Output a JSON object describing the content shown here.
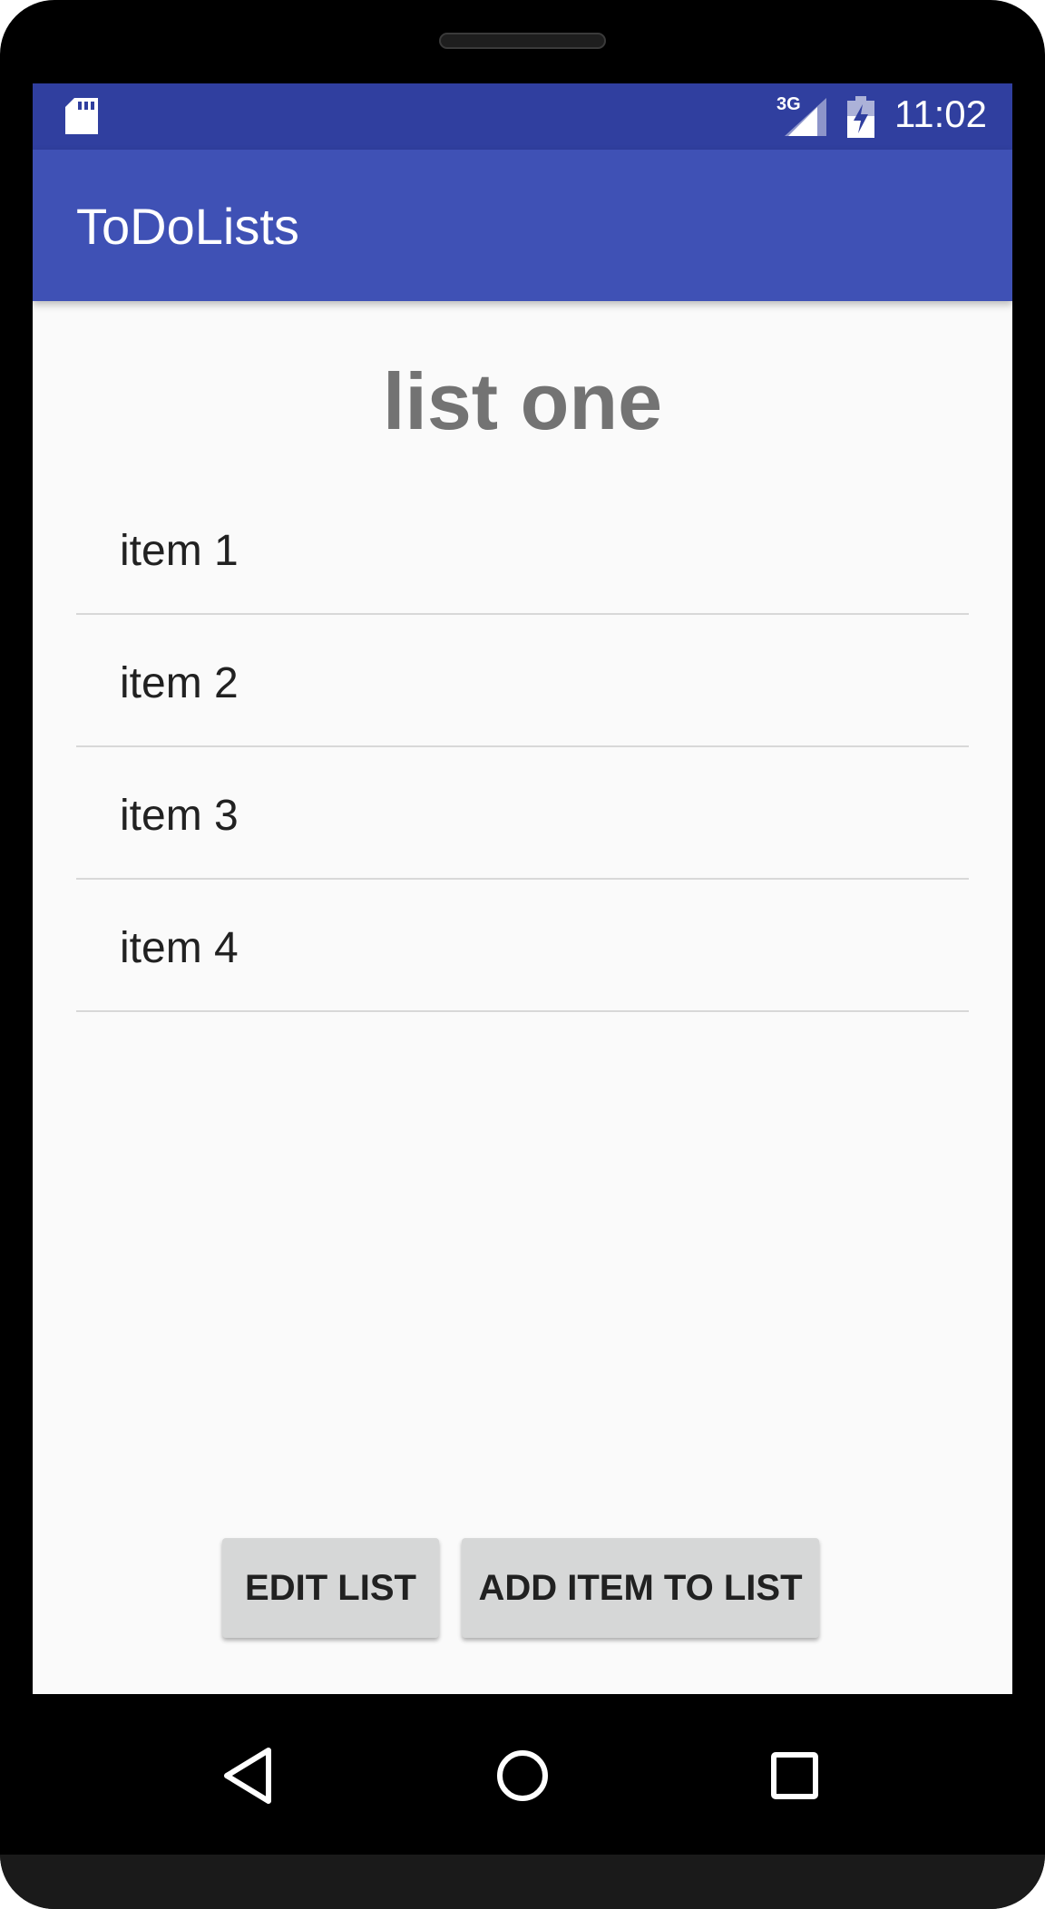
{
  "status_bar": {
    "network": "3G",
    "time": "11:02",
    "icons": [
      "sd-card-icon",
      "signal-icon",
      "battery-charging-icon"
    ]
  },
  "app_bar": {
    "title": "ToDoLists"
  },
  "list": {
    "title": "list one",
    "items": [
      {
        "label": "item 1"
      },
      {
        "label": "item 2"
      },
      {
        "label": "item 3"
      },
      {
        "label": "item 4"
      }
    ]
  },
  "actions": {
    "edit_label": "EDIT LIST",
    "add_label": "ADD ITEM TO LIST"
  },
  "nav_bar": {
    "icons": [
      "back-icon",
      "home-icon",
      "recents-icon"
    ]
  },
  "colors": {
    "status_bar": "#303f9f",
    "app_bar": "#3f51b5",
    "background": "#fafafa",
    "button": "#d6d7d7"
  }
}
